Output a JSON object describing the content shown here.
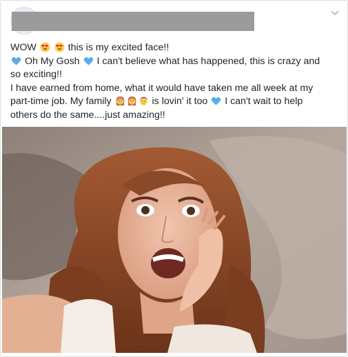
{
  "post": {
    "lines": [
      {
        "segments": [
          {
            "t": "text",
            "v": "WOW "
          },
          {
            "t": "emoji",
            "icon": "heart-eyes"
          },
          {
            "t": "text",
            "v": " "
          },
          {
            "t": "emoji",
            "icon": "heart-eyes"
          },
          {
            "t": "text",
            "v": " this is my excited face!!"
          }
        ]
      },
      {
        "segments": [
          {
            "t": "emoji",
            "icon": "blue-heart"
          },
          {
            "t": "text",
            "v": " Oh My Gosh "
          },
          {
            "t": "emoji",
            "icon": "blue-heart"
          },
          {
            "t": "text",
            "v": " I can't believe what has happened, this is crazy and"
          }
        ]
      },
      {
        "segments": [
          {
            "t": "text",
            "v": "so exciting!!"
          }
        ]
      },
      {
        "segments": [
          {
            "t": "text",
            "v": "I have earned from home, what it would have taken me all week at my"
          }
        ]
      },
      {
        "segments": [
          {
            "t": "text",
            "v": "part-time job. My family "
          },
          {
            "t": "emoji",
            "icon": "woman-face"
          },
          {
            "t": "emoji",
            "icon": "woman-face"
          },
          {
            "t": "emoji",
            "icon": "man-face"
          },
          {
            "t": "text",
            "v": " is lovin' it too "
          },
          {
            "t": "emoji",
            "icon": "blue-heart"
          },
          {
            "t": "text",
            "v": " I can't wait to help"
          }
        ]
      },
      {
        "segments": [
          {
            "t": "text",
            "v": "others do the same....just amazing!!"
          }
        ]
      }
    ]
  },
  "header": {
    "options_icon": "chevron-down-icon",
    "avatar_icon": "profile-avatar"
  },
  "photo": {
    "subject": "excited-woman-selfie",
    "colors": {
      "couch": "#a8998d",
      "hair": "#8a4a2a",
      "skin": "#e8b59a"
    }
  },
  "colors": {
    "text": "#1d2129",
    "border": "#dddfe2",
    "redaction": "#9b9b9b",
    "blue_heart": "#55acee",
    "emoji_face": "#ffcc4d"
  }
}
